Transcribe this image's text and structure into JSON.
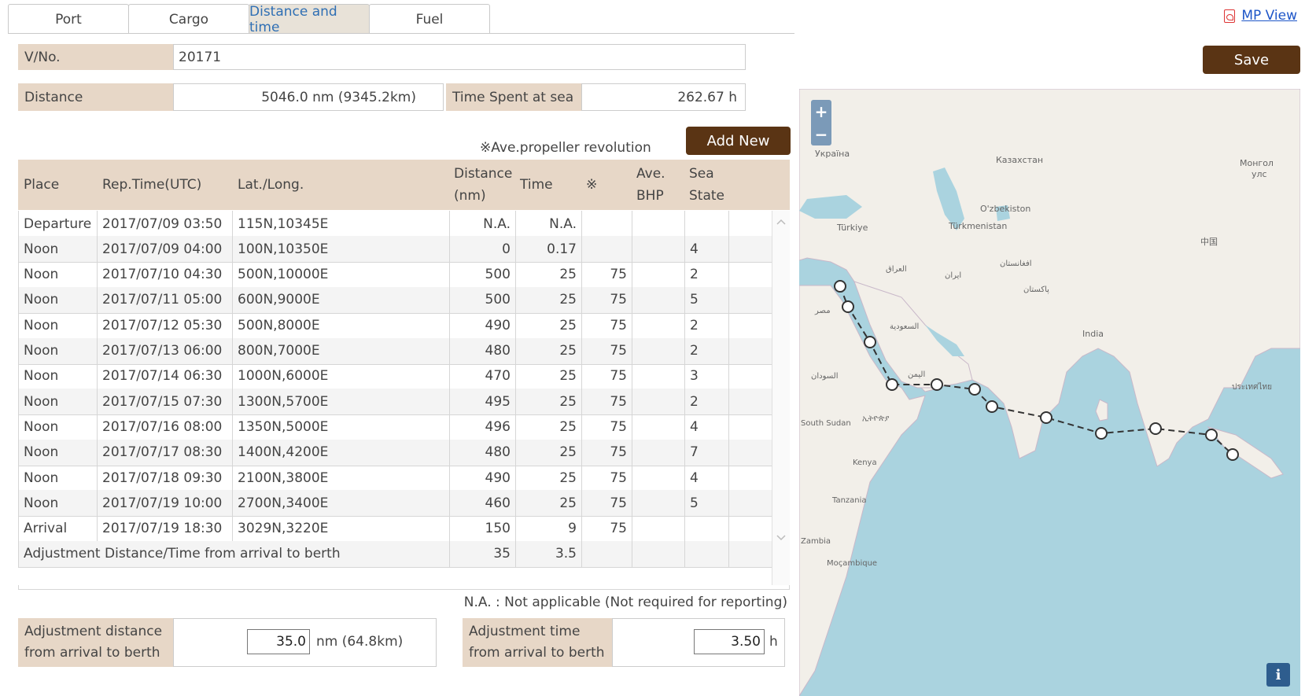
{
  "tabs": [
    "Port",
    "Cargo",
    "Distance and time",
    "Fuel"
  ],
  "active_tab": 2,
  "mp_link": "MP View",
  "save_label": "Save",
  "add_label": "Add New",
  "vno": {
    "label": "V/No.",
    "value": "20171"
  },
  "distance": {
    "label": "Distance",
    "value": "5046.0 nm (9345.2km)"
  },
  "time_sea": {
    "label": "Time Spent at sea",
    "value": "262.67 h"
  },
  "prop_note": "※Ave.propeller revolution",
  "headers": {
    "place": "Place",
    "rep_time": "Rep.Time(UTC)",
    "latlong": "Lat./Long.",
    "distance_1": "Distance",
    "distance_2": "(nm)",
    "time": "Time",
    "mark": "※",
    "bhp_1": "Ave.",
    "bhp_2": "BHP",
    "sea_1": "Sea",
    "sea_2": "State"
  },
  "rows": [
    {
      "place": "Departure",
      "time_utc": "2017/07/09 03:50",
      "pos": "115N,10345E",
      "dist": "N.A.",
      "time": "N.A.",
      "rev": "",
      "bhp": "",
      "sea": ""
    },
    {
      "place": "Noon",
      "time_utc": "2017/07/09 04:00",
      "pos": "100N,10350E",
      "dist": "0",
      "time": "0.17",
      "rev": "",
      "bhp": "",
      "sea": "4"
    },
    {
      "place": "Noon",
      "time_utc": "2017/07/10 04:30",
      "pos": "500N,10000E",
      "dist": "500",
      "time": "25",
      "rev": "75",
      "bhp": "",
      "sea": "2"
    },
    {
      "place": "Noon",
      "time_utc": "2017/07/11 05:00",
      "pos": "600N,9000E",
      "dist": "500",
      "time": "25",
      "rev": "75",
      "bhp": "",
      "sea": "5"
    },
    {
      "place": "Noon",
      "time_utc": "2017/07/12 05:30",
      "pos": "500N,8000E",
      "dist": "490",
      "time": "25",
      "rev": "75",
      "bhp": "",
      "sea": "2"
    },
    {
      "place": "Noon",
      "time_utc": "2017/07/13 06:00",
      "pos": "800N,7000E",
      "dist": "480",
      "time": "25",
      "rev": "75",
      "bhp": "",
      "sea": "2"
    },
    {
      "place": "Noon",
      "time_utc": "2017/07/14 06:30",
      "pos": "1000N,6000E",
      "dist": "470",
      "time": "25",
      "rev": "75",
      "bhp": "",
      "sea": "3"
    },
    {
      "place": "Noon",
      "time_utc": "2017/07/15 07:30",
      "pos": "1300N,5700E",
      "dist": "495",
      "time": "25",
      "rev": "75",
      "bhp": "",
      "sea": "2"
    },
    {
      "place": "Noon",
      "time_utc": "2017/07/16 08:00",
      "pos": "1350N,5000E",
      "dist": "496",
      "time": "25",
      "rev": "75",
      "bhp": "",
      "sea": "4"
    },
    {
      "place": "Noon",
      "time_utc": "2017/07/17 08:30",
      "pos": "1400N,4200E",
      "dist": "480",
      "time": "25",
      "rev": "75",
      "bhp": "",
      "sea": "7"
    },
    {
      "place": "Noon",
      "time_utc": "2017/07/18 09:30",
      "pos": "2100N,3800E",
      "dist": "490",
      "time": "25",
      "rev": "75",
      "bhp": "",
      "sea": "4"
    },
    {
      "place": "Noon",
      "time_utc": "2017/07/19 10:00",
      "pos": "2700N,3400E",
      "dist": "460",
      "time": "25",
      "rev": "75",
      "bhp": "",
      "sea": "5"
    },
    {
      "place": "Arrival",
      "time_utc": "2017/07/19 18:30",
      "pos": "3029N,3220E",
      "dist": "150",
      "time": "9",
      "rev": "75",
      "bhp": "",
      "sea": ""
    }
  ],
  "adjust_row": {
    "label": "Adjustment Distance/Time from arrival to berth",
    "dist": "35",
    "time": "3.5"
  },
  "na_note": "N.A. : Not applicable (Not required for reporting)",
  "adj_dist": {
    "label_1": "Adjustment distance",
    "label_2": "from arrival to berth",
    "value": "35.0",
    "unit": "nm (64.8km)"
  },
  "adj_time": {
    "label_1": "Adjustment time",
    "label_2": "from arrival to berth",
    "value": "3.50",
    "unit": "h"
  },
  "map": {
    "zoom_in": "+",
    "zoom_out": "−",
    "info": "i",
    "labels": [
      "Україна",
      "Казахстан",
      "Монгол",
      "улс",
      "O'zbekiston",
      "Türkiye",
      "Türkmenistan",
      "中国",
      "العراق",
      "ایران",
      "افغانستان",
      "پاکستان",
      "مصر",
      "السعودية",
      "India",
      "السودان",
      "اليمن",
      "ประเทศไทย",
      "ኢትዮጵያ",
      "South Sudan",
      "Kenya",
      "Tanzania",
      "Moçambique",
      "Zambia"
    ]
  },
  "colors": {
    "label_bg": "#e7d7c7",
    "button": "#5a3414",
    "water": "#aad3df",
    "land": "#f2efe9"
  }
}
